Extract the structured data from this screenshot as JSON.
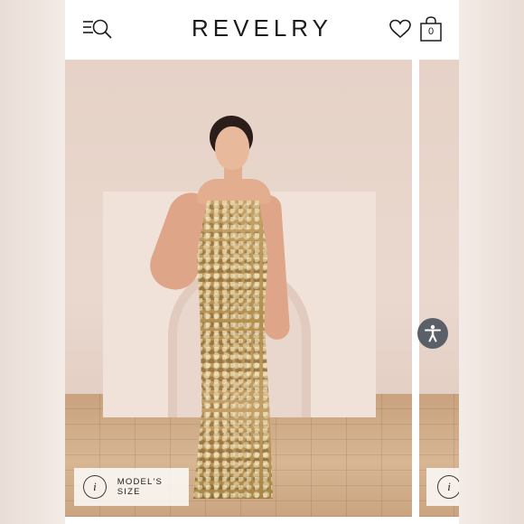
{
  "header": {
    "brand": "REVELRY",
    "bag_count": "0"
  },
  "gallery": {
    "models_size_label": "MODEL'S SIZE",
    "info_glyph": "i"
  },
  "icons": {
    "menu": "menu-search-icon",
    "wishlist": "heart-icon",
    "bag": "shopping-bag-icon",
    "info": "info-icon",
    "accessibility": "accessibility-icon"
  },
  "colors": {
    "text": "#1b1b1b",
    "accessibility_button": "#5b5f67"
  }
}
